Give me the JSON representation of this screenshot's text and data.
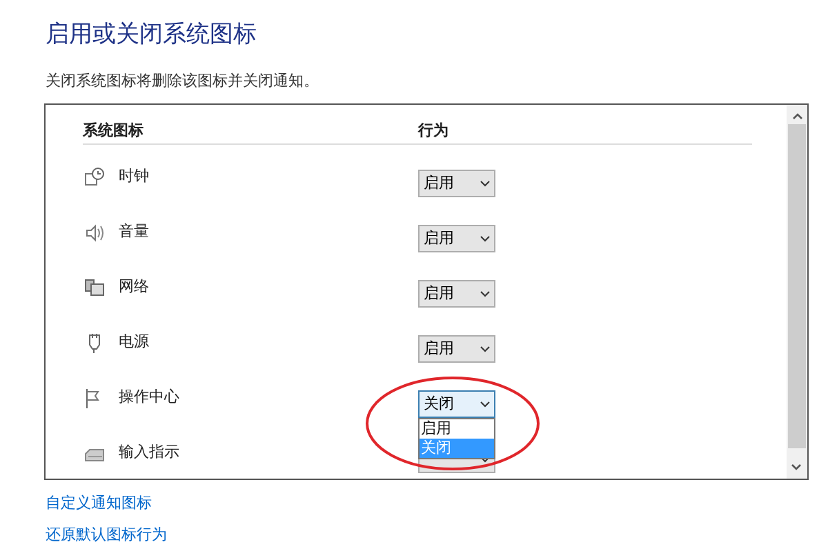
{
  "title": "启用或关闭系统图标",
  "subtitle": "关闭系统图标将删除该图标并关闭通知。",
  "table": {
    "columns": [
      "系统图标",
      "行为"
    ],
    "rows": [
      {
        "kind": "clock",
        "name": "时钟",
        "value": "启用",
        "expanded": false
      },
      {
        "kind": "volume",
        "name": "音量",
        "value": "启用",
        "expanded": false
      },
      {
        "kind": "network",
        "name": "网络",
        "value": "启用",
        "expanded": false
      },
      {
        "kind": "power",
        "name": "电源",
        "value": "启用",
        "expanded": false
      },
      {
        "kind": "flag",
        "name": "操作中心",
        "value": "关闭",
        "expanded": true,
        "options": [
          {
            "label": "启用",
            "selected": false
          },
          {
            "label": "关闭",
            "selected": true
          }
        ]
      },
      {
        "kind": "keyboard",
        "name": "输入指示",
        "expanded": false
      }
    ]
  },
  "links": [
    "自定义通知图标",
    "还原默认图标行为"
  ],
  "annotation": {
    "kind": "ellipse",
    "color": "#e0262b"
  }
}
